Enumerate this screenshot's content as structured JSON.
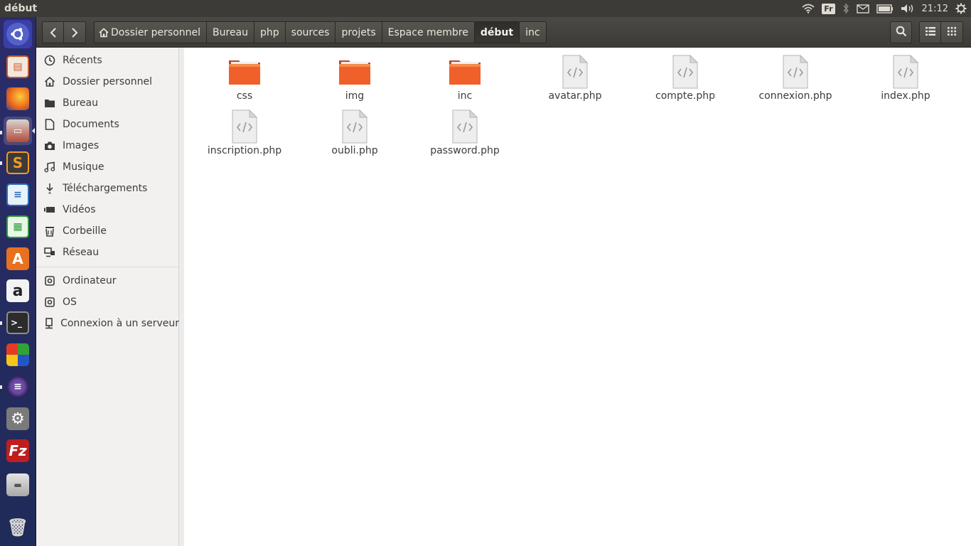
{
  "panel": {
    "title": "début",
    "keyboard_layout": "Fr",
    "clock": "21:12"
  },
  "toolbar": {
    "breadcrumbs": [
      {
        "label": "Dossier personnel"
      },
      {
        "label": "Bureau"
      },
      {
        "label": "php"
      },
      {
        "label": "sources"
      },
      {
        "label": "projets"
      },
      {
        "label": "Espace membre"
      },
      {
        "label": "début"
      },
      {
        "label": "inc"
      }
    ]
  },
  "sidebar": {
    "items": [
      {
        "label": "Récents",
        "icon": "clock-icon"
      },
      {
        "label": "Dossier personnel",
        "icon": "home-icon"
      },
      {
        "label": "Bureau",
        "icon": "folder-icon"
      },
      {
        "label": "Documents",
        "icon": "document-icon"
      },
      {
        "label": "Images",
        "icon": "camera-icon"
      },
      {
        "label": "Musique",
        "icon": "music-icon"
      },
      {
        "label": "Téléchargements",
        "icon": "download-icon"
      },
      {
        "label": "Vidéos",
        "icon": "video-icon"
      },
      {
        "label": "Corbeille",
        "icon": "trash-icon"
      },
      {
        "label": "Réseau",
        "icon": "network-icon"
      },
      {
        "label": "Ordinateur",
        "icon": "drive-icon"
      },
      {
        "label": "OS",
        "icon": "drive-icon"
      },
      {
        "label": "Connexion à un serveur",
        "icon": "server-icon"
      }
    ]
  },
  "files": [
    {
      "name": "css",
      "type": "folder"
    },
    {
      "name": "img",
      "type": "folder"
    },
    {
      "name": "inc",
      "type": "folder"
    },
    {
      "name": "avatar.php",
      "type": "php"
    },
    {
      "name": "compte.php",
      "type": "php"
    },
    {
      "name": "connexion.php",
      "type": "php"
    },
    {
      "name": "index.php",
      "type": "php"
    },
    {
      "name": "inscription.php",
      "type": "php"
    },
    {
      "name": "oubli.php",
      "type": "php"
    },
    {
      "name": "password.php",
      "type": "php"
    }
  ],
  "launcher": [
    {
      "icon": "ubuntu-dash-icon"
    },
    {
      "icon": "libreoffice-impress-icon"
    },
    {
      "icon": "firefox-icon"
    },
    {
      "icon": "file-manager-icon"
    },
    {
      "icon": "sublime-text-icon"
    },
    {
      "icon": "libreoffice-writer-icon"
    },
    {
      "icon": "libreoffice-calc-icon"
    },
    {
      "icon": "software-center-icon"
    },
    {
      "icon": "amazon-icon"
    },
    {
      "icon": "terminal-icon"
    },
    {
      "icon": "windows-app-icon"
    },
    {
      "icon": "eclipse-icon"
    },
    {
      "icon": "system-settings-icon"
    },
    {
      "icon": "filezilla-icon"
    },
    {
      "icon": "drive-icon"
    },
    {
      "icon": "trash-icon"
    }
  ],
  "colors": {
    "folder_orange": "#f0602a",
    "toolbar_dark": "#3c3b37",
    "launcher_blue": "#2c2c6a"
  }
}
